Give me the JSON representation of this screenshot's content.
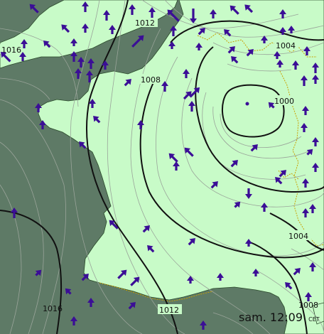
{
  "map": {
    "isobar_labels": [
      "1012",
      "1016",
      "1004",
      "1008",
      "1000",
      "1004",
      "1016",
      "1012",
      "1008"
    ],
    "timestamp": {
      "day": "sam.",
      "time": "12:09",
      "zone": "CET"
    },
    "colors": {
      "sea": "#5e7a66",
      "land": "#c8fbc8",
      "isobar_major": "#111111",
      "isobar_minor": "#9aa49a",
      "wind_arrow": "#3b0e96",
      "border": "#c8a000"
    },
    "low_pressure_center": "1000",
    "wind_arrow_icon": "wind-arrow-icon"
  }
}
